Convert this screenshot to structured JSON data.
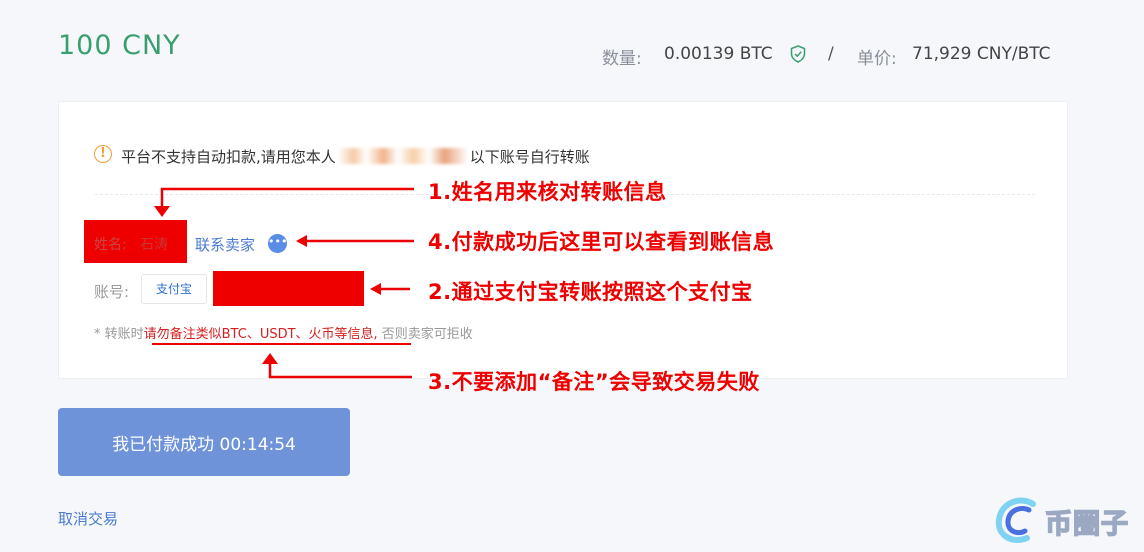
{
  "header": {
    "amount": "100  CNY",
    "quantity_label": "数量:",
    "quantity_value": "0.00139 BTC",
    "separator": "/",
    "price_label": "单价:",
    "price_value": "71,929 CNY/BTC"
  },
  "notice": {
    "prefix": "平台不支持自动扣款,请用您本人",
    "suffix": "以下账号自行转账"
  },
  "seller": {
    "name_label": "姓名:",
    "name_value": "石涛",
    "contact_label": "联系卖家",
    "chat_icon_glyph": "•••"
  },
  "account": {
    "label": "账号:",
    "method": "支付宝"
  },
  "remark": {
    "prefix": "* 转账时",
    "warning": "请勿备注类似BTC、USDT、火币等信息,",
    "suffix": " 否则卖家可拒收"
  },
  "annotations": {
    "a1": "1.姓名用来核对转账信息",
    "a4": "4.付款成功后这里可以查看到账信息",
    "a2": "2.通过支付宝转账按照这个支付宝",
    "a3": "3.不要添加“备注”会导致交易失败"
  },
  "actions": {
    "paid_button": "我已付款成功 00:14:54",
    "cancel_link": "取消交易"
  },
  "watermark": {
    "text": "币圈子"
  },
  "colors": {
    "amount_green": "#3a9e6e",
    "annotation_red": "#ee0000",
    "link_blue": "#4a7bd0",
    "button_blue": "#6f93d9"
  }
}
